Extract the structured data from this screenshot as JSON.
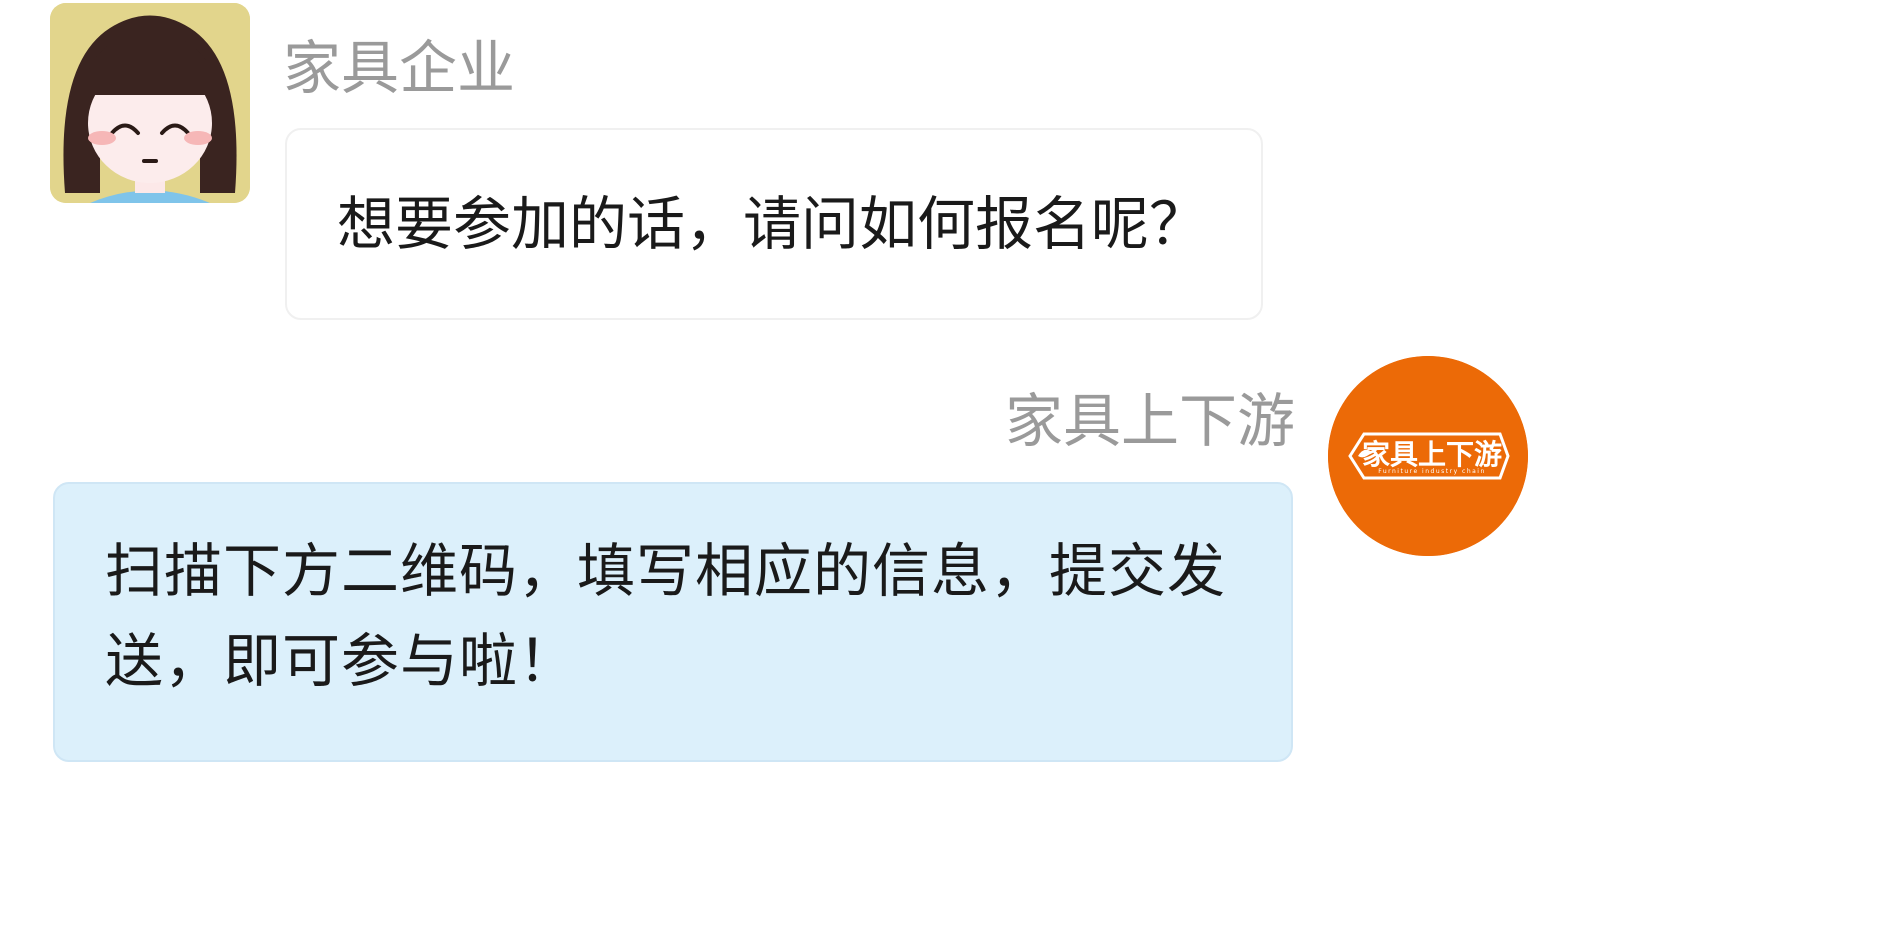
{
  "messages": [
    {
      "sender": "家具企业",
      "side": "left",
      "avatar": "cartoon-girl-avatar",
      "text": "想要参加的话，请问如何报名呢？"
    },
    {
      "sender": "家具上下游",
      "side": "right",
      "avatar": "brand-logo-avatar",
      "logo_text": "家具上下游",
      "logo_subtext": "Furniture industry chain",
      "text": "扫描下方二维码，填写相应的信息，提交发送，即可参与啦！"
    }
  ],
  "colors": {
    "sender_name": "#9a9a9a",
    "left_bubble_bg": "#ffffff",
    "right_bubble_bg": "#dcf0fb",
    "logo_bg": "#ec6a07",
    "avatar_left_bg": "#e2d58c"
  }
}
